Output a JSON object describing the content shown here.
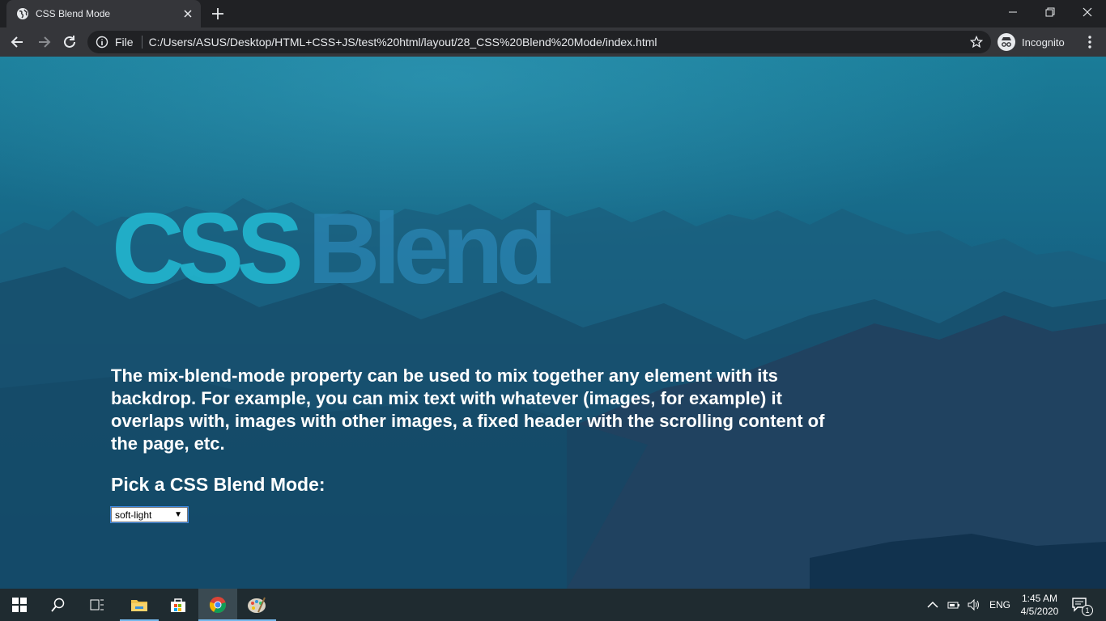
{
  "browser": {
    "tab": {
      "title": "CSS Blend Mode"
    },
    "omnibox": {
      "scheme_label": "File",
      "url": "C:/Users/ASUS/Desktop/HTML+CSS+JS/test%20html/layout/28_CSS%20Blend%20Mode/index.html"
    },
    "profile": {
      "label": "Incognito"
    }
  },
  "page": {
    "heading_word1": "CSS",
    "heading_word2": "Blend",
    "description": "The mix-blend-mode property can be used to mix together any element with its backdrop. For example, you can mix text with whatever (images, for example) it overlaps with, images with other images, a fixed header with the scrolling content of the page, etc.",
    "pick_label": "Pick a CSS Blend Mode:",
    "select": {
      "value": "soft-light"
    }
  },
  "taskbar": {
    "language": "ENG",
    "time": "1:45 AM",
    "date": "4/5/2020",
    "notification_count": "1"
  },
  "colors": {
    "heading_css": "#22b6cf",
    "heading_blend": "#2a86b4",
    "background_top": "#1a7c98",
    "background_bottom": "#123f63"
  }
}
